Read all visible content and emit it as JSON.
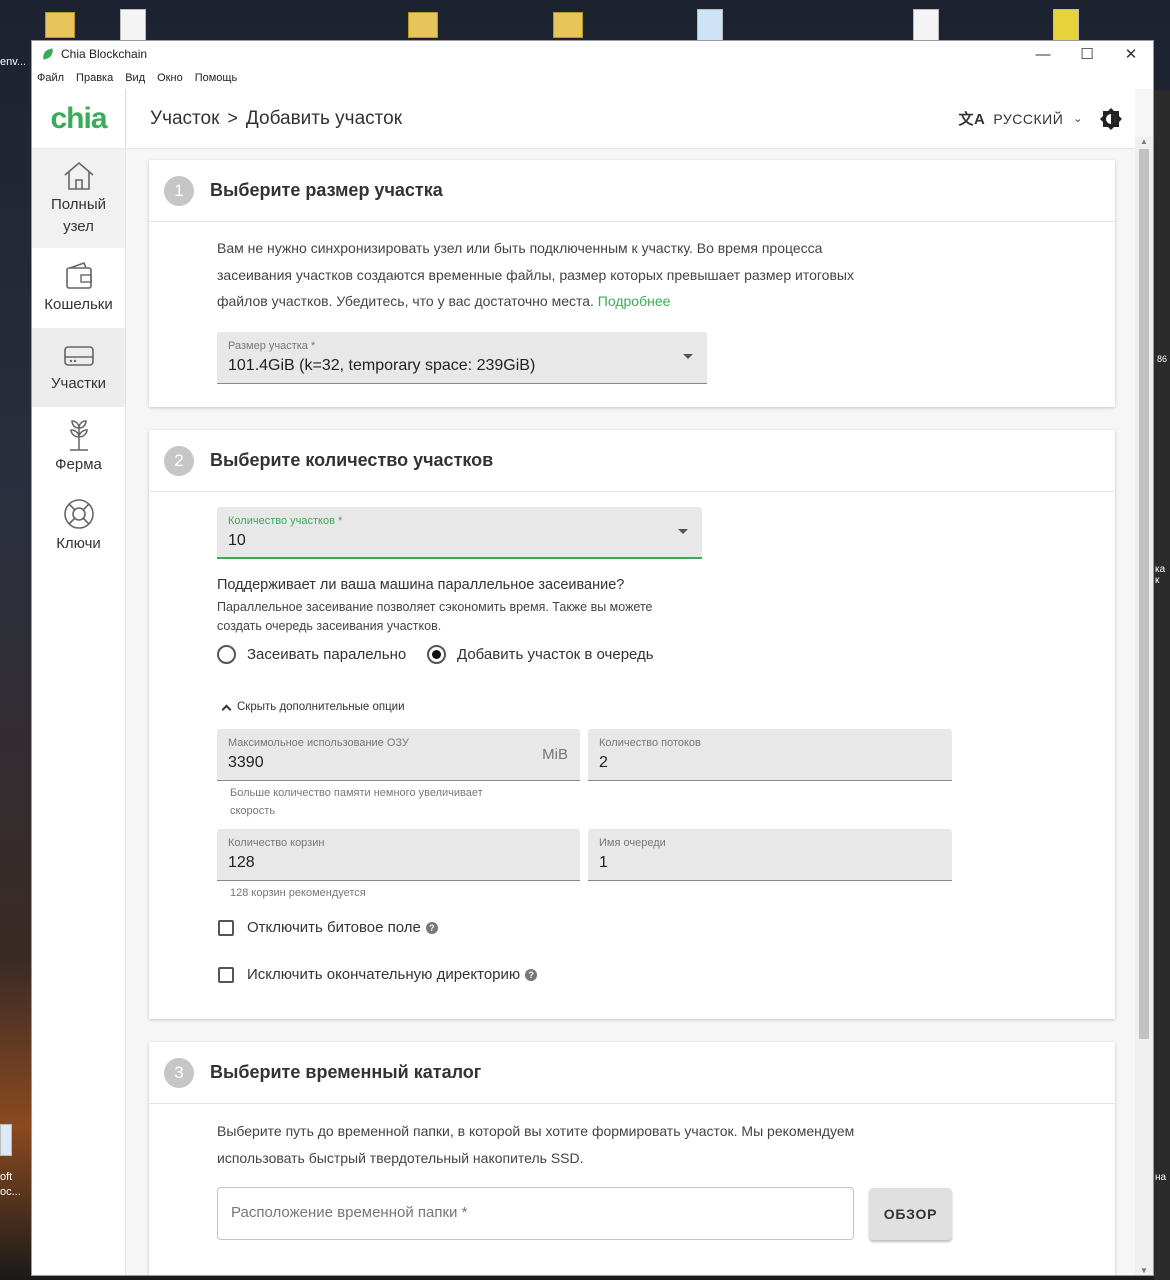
{
  "desktop": {
    "left_label_top": "env...",
    "left_label_bottom_1": "oft",
    "left_label_bottom_2": "oc...",
    "right_label_1": "ка к",
    "right_label_2": "на",
    "right_number": "86"
  },
  "window": {
    "title": "Chia Blockchain",
    "controls": {
      "minimize": "—",
      "maximize": "☐",
      "close": "✕"
    }
  },
  "menu": [
    "Файл",
    "Правка",
    "Вид",
    "Окно",
    "Помощь"
  ],
  "sidebar": {
    "logo": "chia",
    "items": [
      {
        "label_1": "Полный",
        "label_2": "узел",
        "icon": "home-icon"
      },
      {
        "label_1": "Кошельки",
        "icon": "wallet-icon"
      },
      {
        "label_1": "Участки",
        "icon": "hard-drive-icon"
      },
      {
        "label_1": "Ферма",
        "icon": "sprout-icon"
      },
      {
        "label_1": "Ключи",
        "icon": "lifebuoy-icon"
      }
    ]
  },
  "header": {
    "crumb_1": "Участок",
    "crumb_sep": ">",
    "crumb_2": "Добавить участок",
    "language": "РУССКИЙ",
    "translate_icon": "文A"
  },
  "step1": {
    "number": "1",
    "title": "Выберите размер участка",
    "text_line_1": "Вам не нужно синхронизировать узел или быть подключенным к участку. Во время процесса",
    "text_line_2": "засеивания участков создаются временные файлы, размер которых превышает размер итоговых",
    "text_line_3": "файлов участков. Убедитесь, что у вас достаточно места.",
    "link": "Подробнее",
    "size_label": "Размер участка *",
    "size_value": "101.4GiB (k=32, temporary space: 239GiB)"
  },
  "step2": {
    "number": "2",
    "title": "Выберите количество участков",
    "count_label": "Количество участков *",
    "count_value": "10",
    "parallel_question": "Поддерживает ли ваша машина параллельное засеивание?",
    "parallel_hint_1": "Параллельное засеивание позволяет сэкономить время. Также вы можете",
    "parallel_hint_2": "создать очередь засеивания участков.",
    "radio_parallel": "Засеивать паралельно",
    "radio_queue": "Добавить участок в очередь",
    "radio_selected": "queue",
    "toggle_advanced": "Скрыть дополнительные опции",
    "ram_label": "Максимольное использование ОЗУ",
    "ram_value": "3390",
    "ram_unit": "MiB",
    "ram_hint_1": "Больше количество памяти немного увеличивает",
    "ram_hint_2": "скорость",
    "threads_label": "Количество потоков",
    "threads_value": "2",
    "buckets_label": "Количество корзин",
    "buckets_value": "128",
    "buckets_hint": "128 корзин рекомендуется",
    "queue_label": "Имя очереди",
    "queue_value": "1",
    "check_bitfield": "Отключить битовое поле",
    "check_exclude": "Исключить окончательную директорию",
    "help_glyph": "?"
  },
  "step3": {
    "number": "3",
    "title": "Выберите временный каталог",
    "text_line_1": "Выберите путь до временной папки, в которой вы хотите формировать участок. Мы рекомендуем",
    "text_line_2": "использовать быстрый твердотельный накопитель SSD.",
    "folder_placeholder": "Расположение временной папки *",
    "browse_label": "ОБЗОР"
  },
  "colors": {
    "accent": "#3aac59",
    "step_circle": "#c6c6c6",
    "field_bg": "#e8e8e8"
  }
}
